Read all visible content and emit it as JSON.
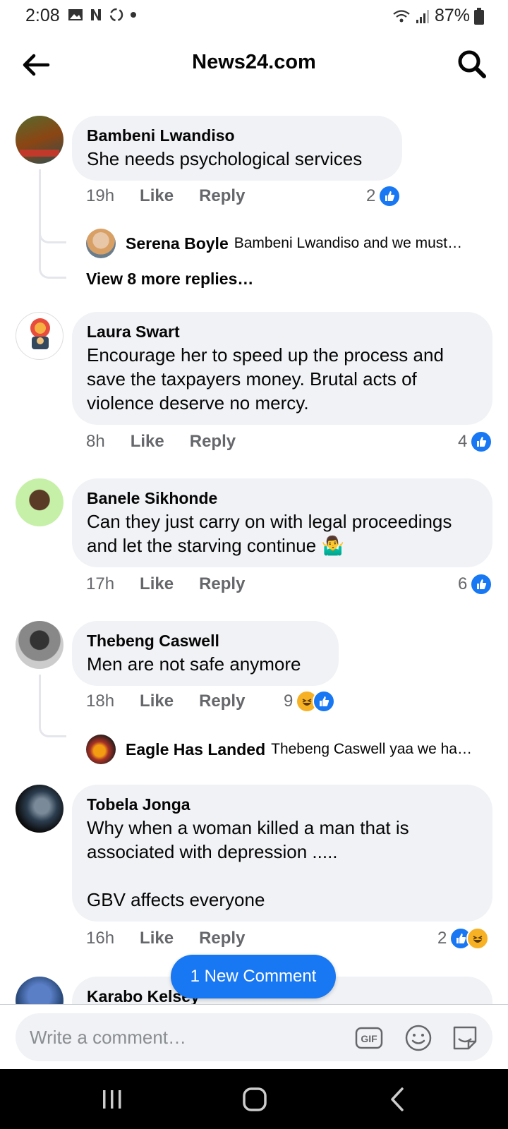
{
  "status_bar": {
    "time": "2:08",
    "battery": "87%"
  },
  "header": {
    "title": "News24.com"
  },
  "comments": [
    {
      "author": "Bambeni Lwandiso",
      "text": "She needs psychological services",
      "time": "19h",
      "like": "Like",
      "reply": "Reply",
      "reaction_count": "2",
      "replies_preview": {
        "author": "Serena Boyle",
        "text": "Bambeni Lwandiso and we must…",
        "view_more": "View 8 more replies…"
      }
    },
    {
      "author": "Laura Swart",
      "text": "Encourage her to speed up the process and save the taxpayers money. Brutal acts of violence deserve no mercy.",
      "time": "8h",
      "like": "Like",
      "reply": "Reply",
      "reaction_count": "4"
    },
    {
      "author": "Banele Sikhonde",
      "text": "Can they just carry on with legal proceedings and let the starving continue 🤷‍♂️",
      "time": "17h",
      "like": "Like",
      "reply": "Reply",
      "reaction_count": "6"
    },
    {
      "author": "Thebeng Caswell",
      "text": "Men are not safe anymore",
      "time": "18h",
      "like": "Like",
      "reply": "Reply",
      "reaction_count": "9",
      "replies_preview": {
        "author": "Eagle Has Landed",
        "text": "Thebeng Caswell yaa we ha…"
      }
    },
    {
      "author": "Tobela Jonga",
      "text": "Why when a woman killed a man that is associated with depression .....\n\nGBV affects everyone",
      "time": "16h",
      "like": "Like",
      "reply": "Reply",
      "reaction_count": "2"
    },
    {
      "author": "Karabo Kelsey"
    }
  ],
  "new_comment_button": "1 New Comment",
  "composer": {
    "placeholder": "Write a comment…",
    "gif_label": "GIF"
  },
  "colors": {
    "accent": "#1877f2",
    "bubble": "#f0f2f5",
    "meta": "#65676b"
  }
}
